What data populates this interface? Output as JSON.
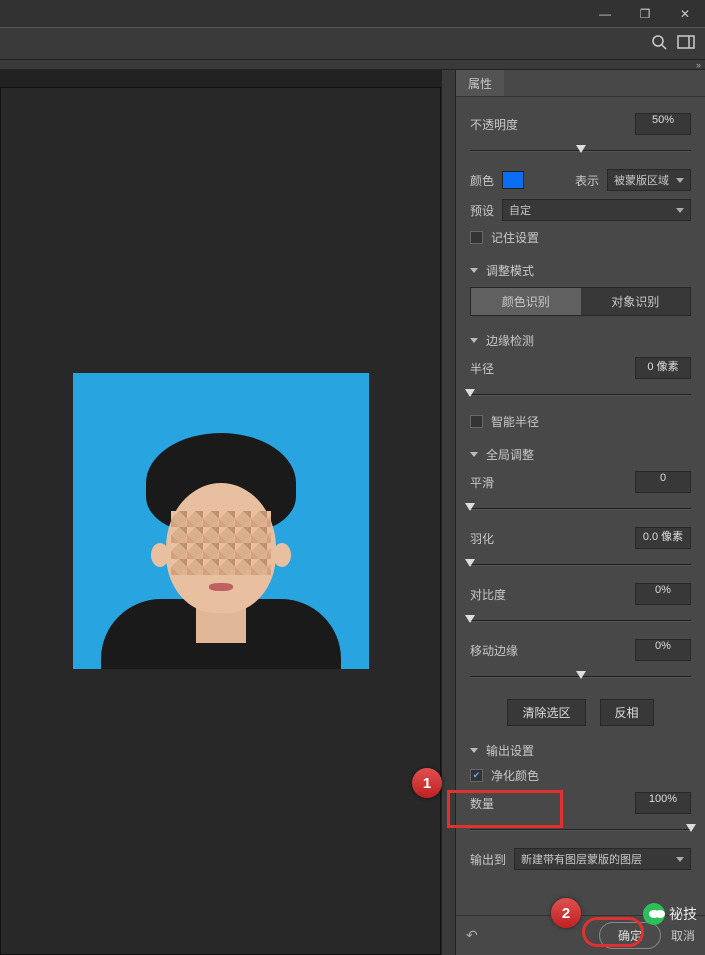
{
  "window": {
    "min": "—",
    "max": "❐",
    "close": "✕"
  },
  "overflow": "»",
  "panel": {
    "tab": "属性",
    "opacity_label": "不透明度",
    "opacity_value": "50%",
    "color_label": "颜色",
    "color_hex": "#0a6ef2",
    "display_label": "表示",
    "display_value": "被蒙版区域",
    "preset_label": "预设",
    "preset_value": "自定",
    "remember_label": "记住设置",
    "remember_checked": false,
    "mode_head": "调整模式",
    "mode_a": "颜色识别",
    "mode_b": "对象识别",
    "edge_head": "边缘检测",
    "radius_label": "半径",
    "radius_value": "0 像素",
    "smart_radius_label": "智能半径",
    "smart_checked": false,
    "global_head": "全局调整",
    "smooth_label": "平滑",
    "smooth_value": "0",
    "feather_label": "羽化",
    "feather_value": "0.0 像素",
    "contrast_label": "对比度",
    "contrast_value": "0%",
    "shift_label": "移动边缘",
    "shift_value": "0%",
    "clear_btn": "清除选区",
    "invert_btn": "反相",
    "output_head": "输出设置",
    "purify_label": "净化颜色",
    "purify_checked": true,
    "amount_label": "数量",
    "amount_value": "100%",
    "output_to_label": "输出到",
    "output_to_value": "新建带有图层蒙版的图层",
    "reset_icon": "↶",
    "ok": "确定",
    "cancel": "取消"
  },
  "badges": {
    "one": "1",
    "two": "2"
  },
  "watermark": "祕技"
}
